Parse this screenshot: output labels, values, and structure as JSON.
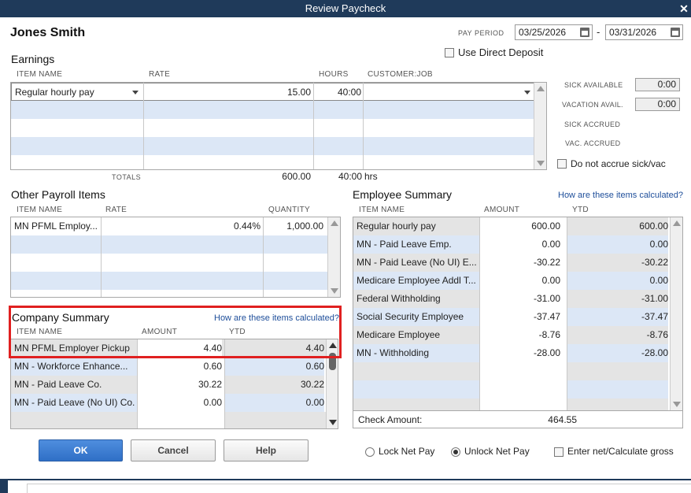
{
  "window": {
    "title": "Review Paycheck",
    "close_glyph": "✕"
  },
  "employee_name": "Jones Smith",
  "pay_period": {
    "label": "PAY PERIOD",
    "start": "03/25/2026",
    "separator": "-",
    "end": "03/31/2026"
  },
  "direct_deposit": {
    "label": "Use Direct Deposit",
    "checked": false
  },
  "earnings": {
    "title": "Earnings",
    "headers": {
      "item": "ITEM NAME",
      "rate": "RATE",
      "hours": "HOURS",
      "customer": "CUSTOMER:JOB"
    },
    "rows": [
      {
        "item": "Regular hourly pay",
        "rate": "15.00",
        "hours": "40:00",
        "customer": ""
      }
    ],
    "totals": {
      "label": "TOTALS",
      "rate": "600.00",
      "hours": "40:00",
      "unit": "hrs"
    }
  },
  "sick_vac": {
    "sick_available": {
      "label": "SICK AVAILABLE",
      "value": "0:00"
    },
    "vacation_available": {
      "label": "VACATION AVAIL.",
      "value": "0:00"
    },
    "sick_accrued": {
      "label": "SICK ACCRUED"
    },
    "vac_accrued": {
      "label": "VAC. ACCRUED"
    },
    "do_not_accrue": {
      "label": "Do not accrue sick/vac",
      "checked": false
    }
  },
  "other_payroll": {
    "title": "Other Payroll Items",
    "headers": {
      "item": "ITEM NAME",
      "rate": "RATE",
      "quantity": "QUANTITY"
    },
    "rows": [
      {
        "item": "MN PFML Employ...",
        "rate": "0.44%",
        "quantity": "1,000.00"
      }
    ]
  },
  "employee_summary": {
    "title": "Employee Summary",
    "link": "How are these items calculated?",
    "headers": {
      "item": "ITEM NAME",
      "amount": "AMOUNT",
      "ytd": "YTD"
    },
    "rows": [
      {
        "item": "Regular hourly pay",
        "amount": "600.00",
        "ytd": "600.00"
      },
      {
        "item": "MN - Paid Leave Emp.",
        "amount": "0.00",
        "ytd": "0.00"
      },
      {
        "item": "MN - Paid Leave (No UI) E...",
        "amount": "-30.22",
        "ytd": "-30.22"
      },
      {
        "item": "Medicare Employee Addl T...",
        "amount": "0.00",
        "ytd": "0.00"
      },
      {
        "item": "Federal Withholding",
        "amount": "-31.00",
        "ytd": "-31.00"
      },
      {
        "item": "Social Security Employee",
        "amount": "-37.47",
        "ytd": "-37.47"
      },
      {
        "item": "Medicare Employee",
        "amount": "-8.76",
        "ytd": "-8.76"
      },
      {
        "item": "MN - Withholding",
        "amount": "-28.00",
        "ytd": "-28.00"
      }
    ],
    "check_amount": {
      "label": "Check Amount:",
      "value": "464.55"
    }
  },
  "company_summary": {
    "title": "Company Summary",
    "link": "How are these items calculated?",
    "headers": {
      "item": "ITEM NAME",
      "amount": "AMOUNT",
      "ytd": "YTD"
    },
    "rows": [
      {
        "item": "MN PFML Employer Pickup",
        "amount": "4.40",
        "ytd": "4.40"
      },
      {
        "item": "MN - Workforce Enhance...",
        "amount": "0.60",
        "ytd": "0.60"
      },
      {
        "item": "MN - Paid Leave Co.",
        "amount": "30.22",
        "ytd": "30.22"
      },
      {
        "item": "MN - Paid Leave (No UI) Co.",
        "amount": "0.00",
        "ytd": "0.00"
      }
    ]
  },
  "buttons": {
    "ok": "OK",
    "cancel": "Cancel",
    "help": "Help"
  },
  "net_pay_options": {
    "lock": {
      "label": "Lock Net Pay",
      "selected": false
    },
    "unlock": {
      "label": "Unlock Net Pay",
      "selected": true
    },
    "enter_net": {
      "label": "Enter net/Calculate gross",
      "checked": false
    }
  },
  "colors": {
    "titlebar": "#1f3a5a",
    "row_alt": "#dce7f6",
    "primary_button": "#3a7bd5",
    "highlight": "#e02020"
  }
}
